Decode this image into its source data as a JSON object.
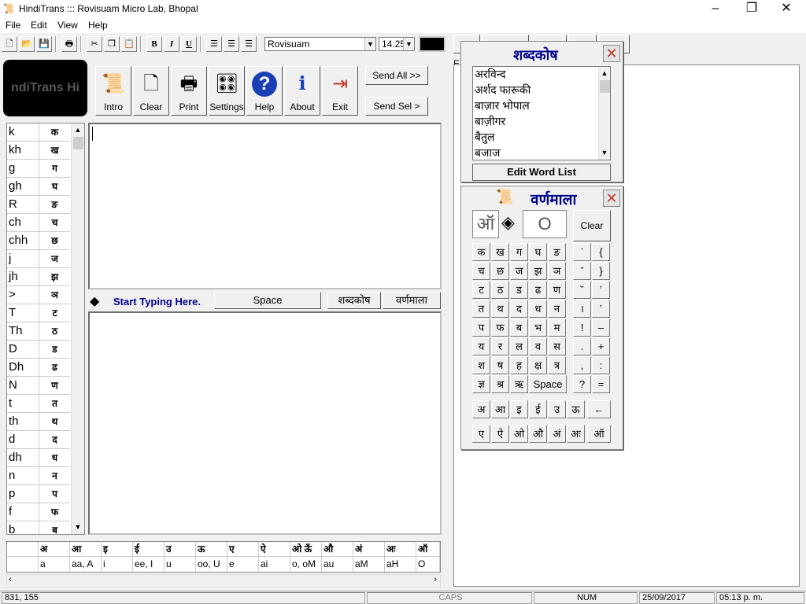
{
  "window": {
    "title": "HindiTrans ::: Rovisuam Micro Lab, Bhopal",
    "app_icon": "scroll-icon",
    "minimize": "–",
    "maximize": "❐",
    "close": "✕"
  },
  "menu": [
    "File",
    "Edit",
    "View",
    "Help"
  ],
  "toolbar": {
    "font_name": "Rovisuam",
    "font_size": "14.25",
    "text_color": "#000000",
    "bold": "B",
    "italic": "I",
    "underline": "U"
  },
  "logo_text": "ndiTrans Hi",
  "big_buttons": [
    {
      "label": "Intro",
      "icon": "scroll-pen-icon"
    },
    {
      "label": "Clear",
      "icon": "blank-page-icon"
    },
    {
      "label": "Print",
      "icon": "printer-icon"
    },
    {
      "label": "Settings",
      "icon": "sliders-icon"
    },
    {
      "label": "Help",
      "icon": "question-icon"
    },
    {
      "label": "About",
      "icon": "info-person-icon"
    },
    {
      "label": "Exit",
      "icon": "exit-door-icon"
    }
  ],
  "send_all": "Send All >>",
  "send_sel": "Send Sel >",
  "keymap": [
    {
      "k": "k",
      "v": "क"
    },
    {
      "k": "kh",
      "v": "ख"
    },
    {
      "k": "g",
      "v": "ग"
    },
    {
      "k": "gh",
      "v": "घ"
    },
    {
      "k": "R",
      "v": "ङ"
    },
    {
      "k": "ch",
      "v": "च"
    },
    {
      "k": "chh",
      "v": "छ"
    },
    {
      "k": "j",
      "v": "ज"
    },
    {
      "k": "jh",
      "v": "झ"
    },
    {
      "k": ">",
      "v": "ञ"
    },
    {
      "k": "T",
      "v": "ट"
    },
    {
      "k": "Th",
      "v": "ठ"
    },
    {
      "k": "D",
      "v": "ड"
    },
    {
      "k": "Dh",
      "v": "ढ"
    },
    {
      "k": "N",
      "v": "ण"
    },
    {
      "k": "t",
      "v": "त"
    },
    {
      "k": "th",
      "v": "थ"
    },
    {
      "k": "d",
      "v": "द"
    },
    {
      "k": "dh",
      "v": "ध"
    },
    {
      "k": "n",
      "v": "न"
    },
    {
      "k": "p",
      "v": "प"
    },
    {
      "k": "f",
      "v": "फ"
    },
    {
      "k": "b",
      "v": "ब"
    }
  ],
  "start_typing": "Start Typing Here.",
  "space_button": "Space",
  "tab_shabdkosh": "शब्दकोष",
  "tab_varnamala": "वर्णमाला",
  "vowels": {
    "heads": [
      "अ",
      "आ",
      "इ",
      "ई",
      "उ",
      "ऊ",
      "ए",
      "ऐ",
      "ओ ऊँ",
      "औ",
      "अं",
      "अः",
      "ऑ"
    ],
    "vals": [
      "a",
      "aa, A",
      "i",
      "ee, I",
      "u",
      "oo, U",
      "e",
      "ai",
      "o, oM",
      "au",
      "aM",
      "aH",
      "O"
    ]
  },
  "status": {
    "coords": "831, 155",
    "caps": "CAPS",
    "num": "NUM",
    "date": "25/09/2017",
    "time": "05:13 p. m."
  },
  "right_label": "E",
  "dict": {
    "title": "शब्दकोष",
    "close": "✕",
    "items": [
      "अरविन्द",
      "अर्शद फारूकी",
      "बाज़ार भोपाल",
      "बाज़ीगर",
      "बैतुल",
      "बजाज"
    ],
    "edit_button": "Edit Word List"
  },
  "varna": {
    "title": "वर्णमाला",
    "close": "✕",
    "preview_left": "ऑ",
    "preview_right": "O",
    "clear": "Clear",
    "grid": [
      [
        "क",
        "ख",
        "ग",
        "घ",
        "ङ"
      ],
      [
        "च",
        "छ",
        "ज",
        "झ",
        "ञ"
      ],
      [
        "ट",
        "ठ",
        "ड",
        "ढ",
        "ण"
      ],
      [
        "त",
        "थ",
        "द",
        "ध",
        "न"
      ],
      [
        "प",
        "फ",
        "ब",
        "भ",
        "म"
      ],
      [
        "य",
        "र",
        "ल",
        "व",
        "स"
      ],
      [
        "श",
        "ष",
        "ह",
        "क्ष",
        "त्र"
      ],
      [
        "ज्ञ",
        "श्र",
        "ऋ"
      ]
    ],
    "space": "Space",
    "signs": [
      [
        "ˋ",
        "{"
      ],
      [
        "ˇ",
        "}"
      ],
      [
        "˘",
        "ʼ"
      ],
      [
        "।",
        "ʼ"
      ],
      [
        "!",
        "–"
      ],
      [
        ".",
        "+"
      ],
      [
        ",",
        ":"
      ],
      [
        "?",
        "="
      ]
    ],
    "vowels_row1": [
      "अ",
      "आ",
      "इ",
      "ई",
      "उ",
      "ऊ",
      "←"
    ],
    "vowels_row2": [
      "ए",
      "ऐ",
      "ओ",
      "औ",
      "अं",
      "अः",
      "ऑ"
    ]
  }
}
